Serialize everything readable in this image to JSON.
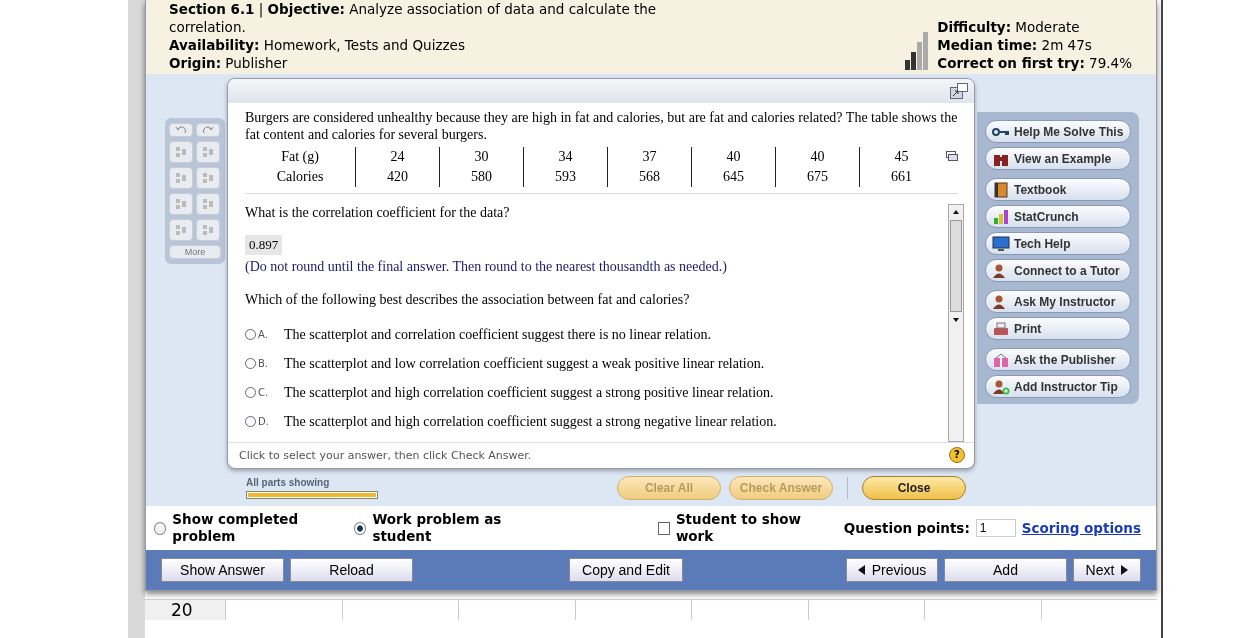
{
  "header": {
    "objective": "**Section 6.1** | **Objective:** Analyze association of data and calculate the correlation.",
    "fields": [
      {
        "label": "Availability:",
        "value": "Homework, Tests and Quizzes"
      },
      {
        "label": "Origin:",
        "value": "Publisher"
      }
    ],
    "stats": [
      {
        "label": "Difficulty:",
        "value": "Moderate"
      },
      {
        "label": "Median time:",
        "value": "2m 47s"
      },
      {
        "label": "Correct on first try:",
        "value": "79.4%"
      }
    ]
  },
  "palette": {
    "more_button": {
      "label": "More",
      "disabled": true
    }
  },
  "question": {
    "intro": "Burgers are considered unhealthy because they are high in fat and calories, but are fat and calories related? The table shows the fat content and calories for several burgers.",
    "table": [
      {
        "header": "Fat (g)",
        "values": [
          "24",
          "30",
          "34",
          "37",
          "40",
          "40",
          "45"
        ]
      },
      {
        "header": "Calories",
        "values": [
          "420",
          "580",
          "593",
          "568",
          "645",
          "675",
          "661"
        ]
      }
    ],
    "prompt": "What is the correlation coefficient for the data?",
    "answer": "0.897",
    "note": "(Do not round until the final answer. Then round to the nearest thousandth as needed.)",
    "prompt_2": "Which of the following best describes the association between fat and calories?",
    "options": [
      {
        "letter": "A.",
        "text": "The scatterplot and correlation coefficient suggest there is no linear relation.",
        "selected": false
      },
      {
        "letter": "B.",
        "text": "The scatterplot and low correlation coefficient suggest a weak positive linear relation.",
        "selected": false
      },
      {
        "letter": "C.",
        "text": "The scatterplot and high correlation coefficient suggest a strong positive linear relation.",
        "selected": false
      },
      {
        "letter": "D.",
        "text": "The scatterplot and high correlation coefficient suggest a strong negative linear relation.",
        "selected": false
      }
    ],
    "hint": "Click to select your answer, then click Check Answer.",
    "help_label": "?"
  },
  "progress": {
    "label": "All parts showing",
    "level": 1
  },
  "actions": [
    {
      "label": "Clear All",
      "disabled": true
    },
    {
      "label": "Check Answer",
      "disabled": true
    },
    {
      "label": "Close",
      "disabled": false
    }
  ],
  "tools": {
    "groups": [
      [
        "Help Me Solve This",
        "View an Example"
      ],
      [
        "Textbook",
        "StatCrunch",
        "Tech Help",
        "Connect to a Tutor"
      ],
      [
        "Ask My Instructor",
        "Print"
      ],
      [
        "Ask the Publisher",
        "Add Instructor Tip"
      ]
    ]
  },
  "modes": [
    {
      "label": "Show completed problem",
      "selected": false
    },
    {
      "label": "Work problem as student",
      "selected": true
    }
  ],
  "show_work": {
    "label": "Student to show work",
    "checked": false
  },
  "points": {
    "label": "Question points:",
    "value": "1",
    "link": "Scoring options"
  },
  "bottom_buttons": [
    {
      "label": "Show Answer",
      "kind": "plain"
    },
    {
      "label": "Reload",
      "kind": "plain"
    },
    {
      "label": "Copy and Edit",
      "kind": "plain"
    },
    {
      "label": "Previous",
      "kind": "back"
    },
    {
      "label": "Add",
      "kind": "plain"
    },
    {
      "label": "Next",
      "kind": "forward"
    }
  ],
  "sheet": {
    "row_label": "20"
  }
}
